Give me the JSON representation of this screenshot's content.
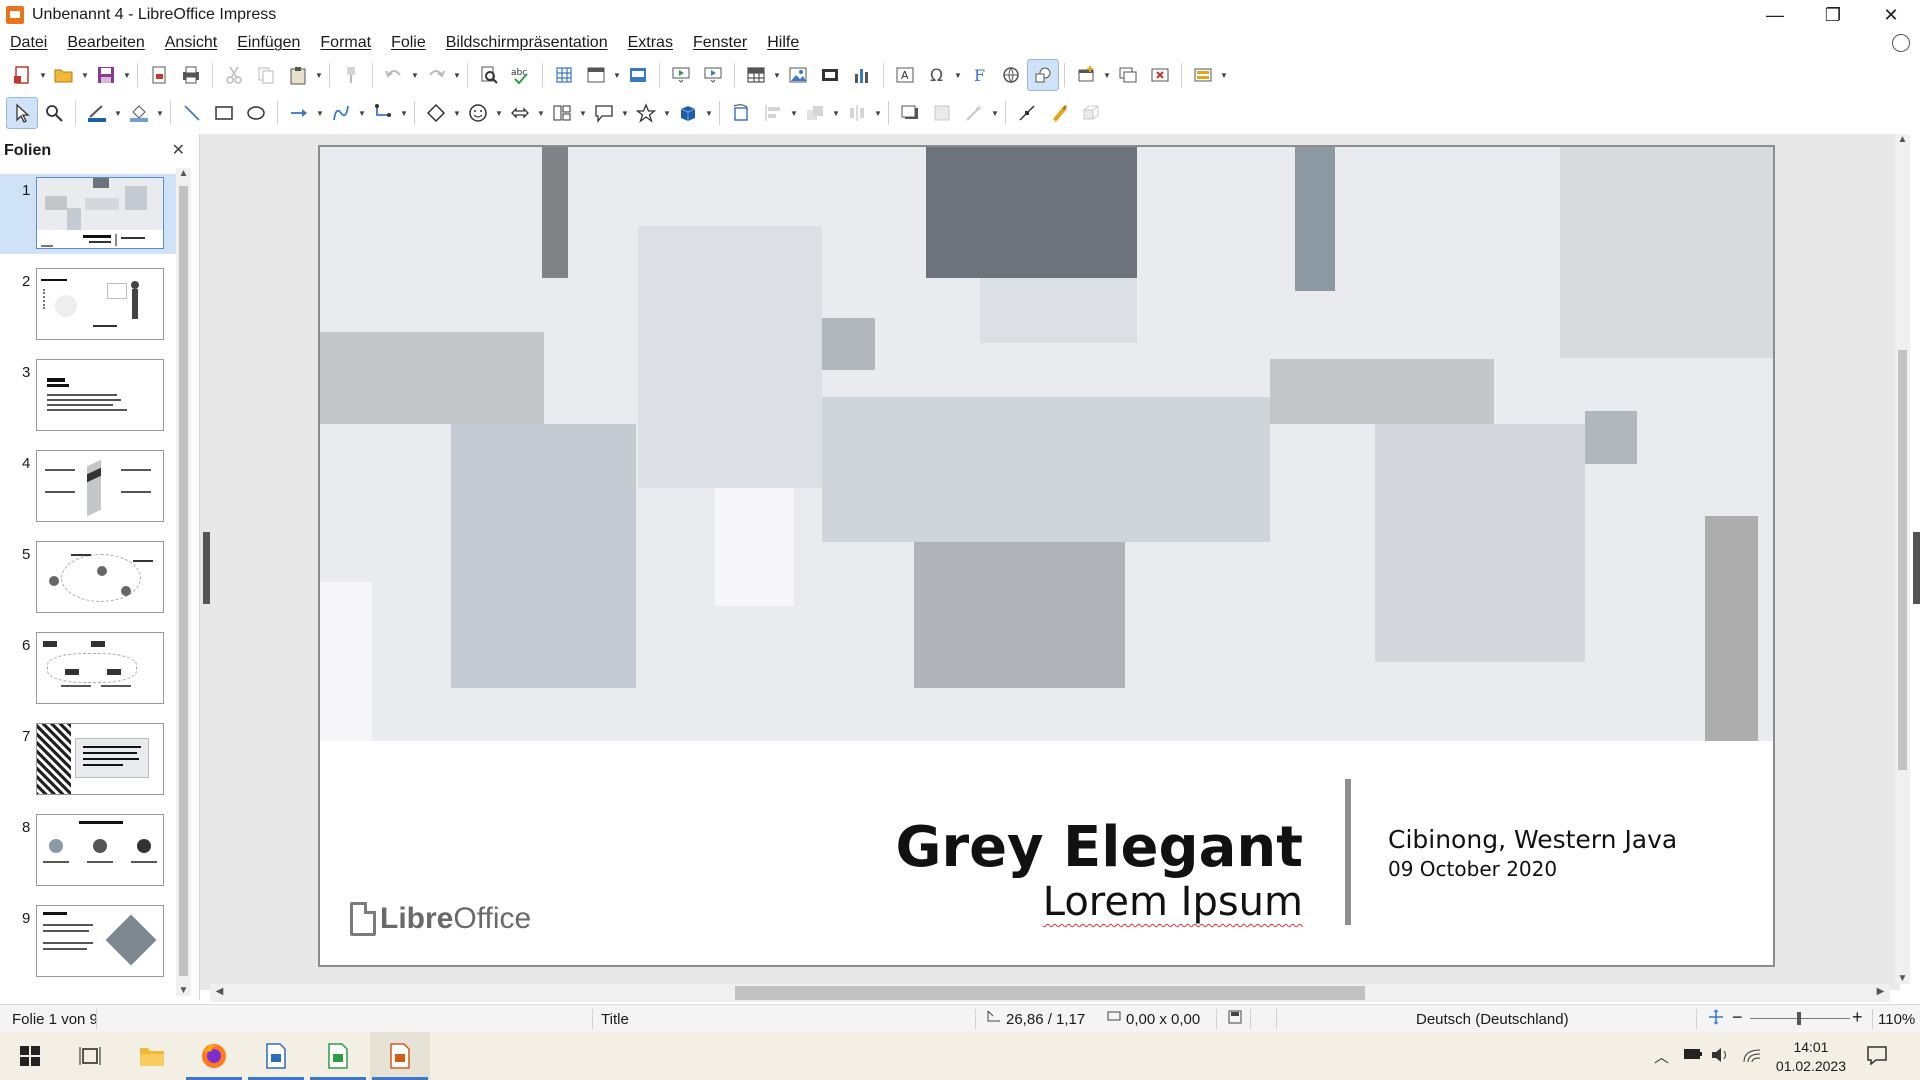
{
  "window": {
    "title": "Unbenannt 4 - LibreOffice Impress",
    "minimize": "—",
    "maximize": "❐",
    "close": "✕"
  },
  "menubar": {
    "items": [
      "Datei",
      "Bearbeiten",
      "Ansicht",
      "Einfügen",
      "Format",
      "Folie",
      "Bildschirmpräsentation",
      "Extras",
      "Fenster",
      "Hilfe"
    ]
  },
  "slides_pane": {
    "title": "Folien",
    "close": "✕",
    "slide_numbers": [
      "1",
      "2",
      "3",
      "4",
      "5",
      "6",
      "7",
      "8",
      "9"
    ],
    "selected_index": 1
  },
  "slide": {
    "title": "Grey Elegant",
    "subtitle": "Lorem Ipsum",
    "place": "Cibinong, Western Java",
    "date": "09 October 2020",
    "logo_bold": "Libre",
    "logo_regular": "Office",
    "colors": {
      "background": "#e9ebee",
      "dark_block": "#6c737c",
      "steel": "#8d99a2",
      "mid_grey": "#c4c6c8",
      "light_block": "#d4d7dc",
      "blue_grey": "#c6cbd3",
      "white_block": "#f6f6f8",
      "accent_bar": "#8f8f8f"
    }
  },
  "statusbar": {
    "slide_position": "Folie 1 von 9",
    "layout": "Title",
    "position": "26,86 / 1,17",
    "size": "0,00 x 0,00",
    "language": "Deutsch (Deutschland)",
    "zoom": "110%"
  },
  "taskbar": {
    "time": "14:01",
    "date": "01.02.2023"
  }
}
